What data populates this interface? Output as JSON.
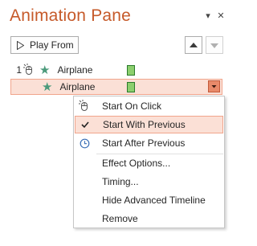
{
  "pane": {
    "title": "Animation Pane",
    "dropdown_icon": "chevron-down-icon",
    "close_icon": "close-icon",
    "close_glyph": "✕",
    "dropdown_glyph": "▾"
  },
  "toolbar": {
    "play_from_label": "Play From",
    "move_up_icon": "triangle-up-icon",
    "move_down_icon": "triangle-down-icon"
  },
  "animations": [
    {
      "number": "1",
      "trigger_icon": "mouse-click-icon",
      "effect_icon": "star-icon",
      "name": "Airplane",
      "selected": false
    },
    {
      "number": "",
      "trigger_icon": "",
      "effect_icon": "star-icon",
      "name": "Airplane",
      "selected": true
    }
  ],
  "context_menu": {
    "items": [
      {
        "label": "Start On Click",
        "icon": "mouse-click-icon",
        "highlighted": false
      },
      {
        "label": "Start With Previous",
        "icon": "checkmark-icon",
        "highlighted": true
      },
      {
        "label": "Start After Previous",
        "icon": "clock-icon",
        "highlighted": false
      },
      {
        "label": "Effect Options...",
        "icon": "",
        "highlighted": false
      },
      {
        "label": "Timing...",
        "icon": "",
        "highlighted": false
      },
      {
        "label": "Hide Advanced Timeline",
        "icon": "",
        "highlighted": false
      },
      {
        "label": "Remove",
        "icon": "",
        "highlighted": false
      }
    ]
  },
  "colors": {
    "title": "#c65a2a",
    "selection_fill": "#fbe0d6",
    "selection_border": "#f1a58c",
    "effect_star": "#4b9a7b",
    "timeline_bar": "#8ccf6e"
  }
}
